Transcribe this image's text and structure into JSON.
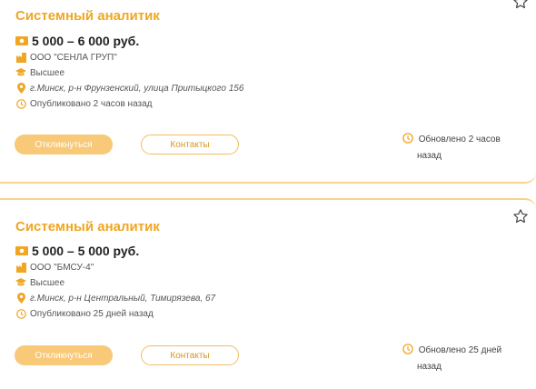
{
  "vacancies": [
    {
      "title": "Системный аналитик",
      "salary": "5 000 – 6 000 руб.",
      "company": "ООО \"СЕНЛА ГРУП\"",
      "education": "Высшее",
      "address": "г.Минск, р-н Фрунзенский, улица Притыцкого 156",
      "published": "Опубликовано 2 часов назад",
      "apply_label": "Откликнуться",
      "contacts_label": "Контакты",
      "updated_line1": "Обновлено 2 часов",
      "updated_line2": "назад"
    },
    {
      "title": "Системный аналитик",
      "salary": "5 000 – 5 000 руб.",
      "company": "ООО \"БМСУ-4\"",
      "education": "Высшее",
      "address": "г.Минск, р-н Центральный, Тимирязева, 67",
      "published": "Опубликовано 25 дней назад",
      "apply_label": "Откликнуться",
      "contacts_label": "Контакты",
      "updated_line1": "Обновлено 25 дней",
      "updated_line2": "назад"
    }
  ],
  "icons": {
    "salary": "money-icon",
    "company": "building-icon",
    "education": "graduation-cap-icon",
    "address": "location-pin-icon",
    "published": "clock-icon",
    "updated": "clock-icon",
    "favorite": "star-icon"
  },
  "colors": {
    "accent": "#f0a623",
    "button_fill": "#f8c978",
    "divider": "#f3d58c"
  }
}
